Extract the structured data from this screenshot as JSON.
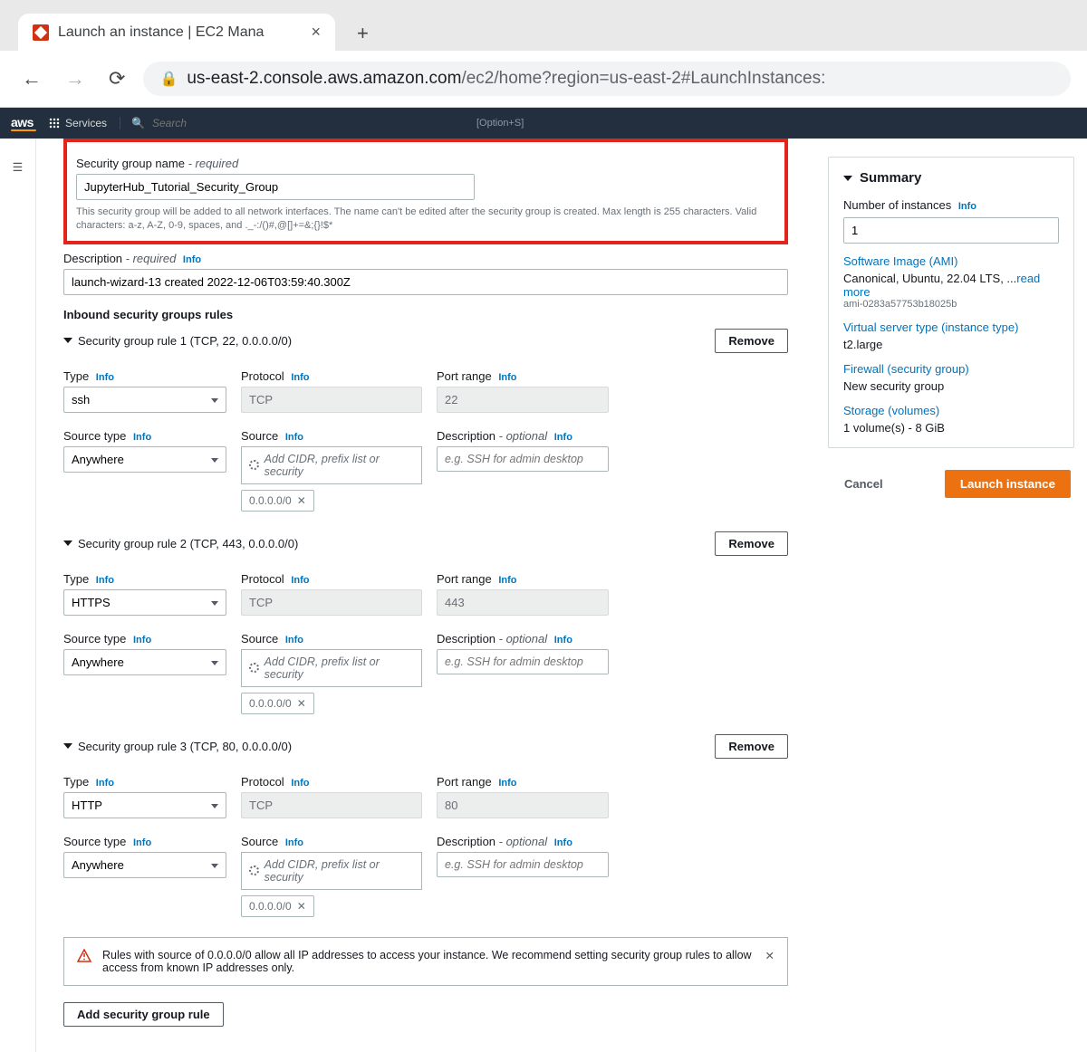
{
  "browser": {
    "tab_title": "Launch an instance | EC2 Mana",
    "url_host": "us-east-2.console.aws.amazon.com",
    "url_path": "/ec2/home?region=us-east-2#LaunchInstances:"
  },
  "aws_nav": {
    "services": "Services",
    "search_placeholder": "Search",
    "shortcut": "[Option+S]"
  },
  "security_group_name": {
    "label": "Security group name",
    "required": "- required",
    "value": "JupyterHub_Tutorial_Security_Group",
    "helper": "This security group will be added to all network interfaces. The name can't be edited after the security group is created. Max length is 255 characters. Valid characters: a-z, A-Z, 0-9, spaces, and ._-:/()#,@[]+=&;{}!$*"
  },
  "description": {
    "label": "Description",
    "required": "- required",
    "info": "Info",
    "value": "launch-wizard-13 created 2022-12-06T03:59:40.300Z"
  },
  "inbound_header": "Inbound security groups rules",
  "rules": [
    {
      "title": "Security group rule 1 (TCP, 22, 0.0.0.0/0)",
      "remove": "Remove",
      "type_label": "Type",
      "type_value": "ssh",
      "protocol_label": "Protocol",
      "protocol_value": "TCP",
      "port_label": "Port range",
      "port_value": "22",
      "source_type_label": "Source type",
      "source_type_value": "Anywhere",
      "source_label": "Source",
      "source_placeholder": "Add CIDR, prefix list or security",
      "source_chip": "0.0.0.0/0",
      "desc_label": "Description",
      "desc_optional": "- optional",
      "desc_placeholder": "e.g. SSH for admin desktop"
    },
    {
      "title": "Security group rule 2 (TCP, 443, 0.0.0.0/0)",
      "remove": "Remove",
      "type_label": "Type",
      "type_value": "HTTPS",
      "protocol_label": "Protocol",
      "protocol_value": "TCP",
      "port_label": "Port range",
      "port_value": "443",
      "source_type_label": "Source type",
      "source_type_value": "Anywhere",
      "source_label": "Source",
      "source_placeholder": "Add CIDR, prefix list or security",
      "source_chip": "0.0.0.0/0",
      "desc_label": "Description",
      "desc_optional": "- optional",
      "desc_placeholder": "e.g. SSH for admin desktop"
    },
    {
      "title": "Security group rule 3 (TCP, 80, 0.0.0.0/0)",
      "remove": "Remove",
      "type_label": "Type",
      "type_value": "HTTP",
      "protocol_label": "Protocol",
      "protocol_value": "TCP",
      "port_label": "Port range",
      "port_value": "80",
      "source_type_label": "Source type",
      "source_type_value": "Anywhere",
      "source_label": "Source",
      "source_placeholder": "Add CIDR, prefix list or security",
      "source_chip": "0.0.0.0/0",
      "desc_label": "Description",
      "desc_optional": "- optional",
      "desc_placeholder": "e.g. SSH for admin desktop"
    }
  ],
  "info": "Info",
  "warning": "Rules with source of 0.0.0.0/0 allow all IP addresses to access your instance. We recommend setting security group rules to allow access from known IP addresses only.",
  "add_rule": "Add security group rule",
  "summary": {
    "title": "Summary",
    "num_label": "Number of instances",
    "num_value": "1",
    "ami_label": "Software Image (AMI)",
    "ami_value": "Canonical, Ubuntu, 22.04 LTS, ...",
    "readmore": "read more",
    "ami_id": "ami-0283a57753b18025b",
    "type_label": "Virtual server type (instance type)",
    "type_value": "t2.large",
    "firewall_label": "Firewall (security group)",
    "firewall_value": "New security group",
    "storage_label": "Storage (volumes)",
    "storage_value": "1 volume(s) - 8 GiB",
    "cancel": "Cancel",
    "launch": "Launch instance"
  }
}
